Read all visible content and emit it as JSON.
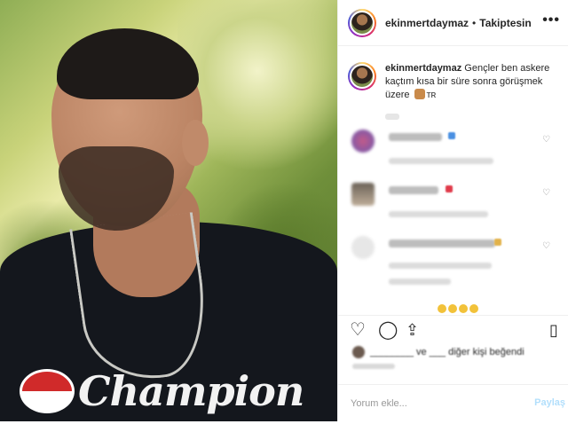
{
  "post": {
    "username": "ekinmertdaymaz",
    "separator": "•",
    "follow_status": "Takiptesin",
    "more_icon": "more-horizontal-icon",
    "photo_logo_text": "Champion",
    "caption": {
      "username": "ekinmertdaymaz",
      "text": "Gençler ben askere kaçtım kısa bir süre sonra görüşmek üzere",
      "flag_text": "TR"
    }
  },
  "comments_icons": {
    "like_icon": "heart-outline-icon"
  },
  "actions": {
    "like_icon": "heart-outline-icon",
    "comment_icon": "comment-bubble-icon",
    "share_icon": "share-icon",
    "save_icon": "bookmark-icon"
  },
  "likes": {
    "text": "beğendi"
  },
  "comment_box": {
    "placeholder": "Yorum ekle...",
    "share_label": "Paylaş"
  },
  "colors": {
    "ring": "#d62976",
    "share_disabled": "#b2dffc"
  }
}
